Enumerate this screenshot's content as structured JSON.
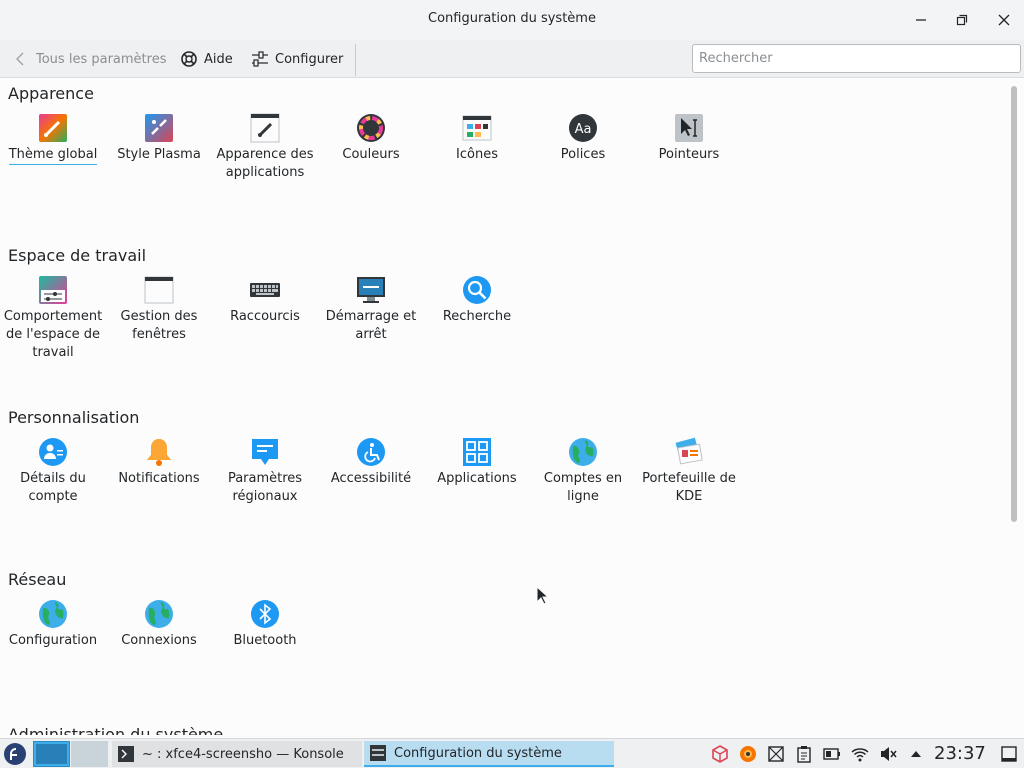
{
  "window": {
    "title": "Configuration du système"
  },
  "toolbar": {
    "back": "Tous les paramètres",
    "help": "Aide",
    "configure": "Configurer"
  },
  "search": {
    "placeholder": "Rechercher"
  },
  "sections": [
    {
      "title": "Apparence",
      "items": [
        "Thème global",
        "Style Plasma",
        "Apparence des applications",
        "Couleurs",
        "Icônes",
        "Polices",
        "Pointeurs"
      ]
    },
    {
      "title": "Espace de travail",
      "items": [
        "Comportement de l'espace de travail",
        "Gestion des fenêtres",
        "Raccourcis",
        "Démarrage et arrêt",
        "Recherche"
      ]
    },
    {
      "title": "Personnalisation",
      "items": [
        "Détails du compte",
        "Notifications",
        "Paramètres régionaux",
        "Accessibilité",
        "Applications",
        "Comptes en ligne",
        "Portefeuille de KDE"
      ]
    },
    {
      "title": "Réseau",
      "items": [
        "Configuration",
        "Connexions",
        "Bluetooth"
      ]
    },
    {
      "title": "Administration du système",
      "items": []
    }
  ],
  "labels": {
    "s0": "Apparence",
    "s1": "Espace de travail",
    "s2": "Personnalisation",
    "s3": "Réseau",
    "s4": "Administration du système",
    "a0a": "Thème global",
    "a1a": "Style Plasma",
    "a2a": "Apparence des",
    "a2b": "applications",
    "a3a": "Couleurs",
    "a4a": "Icônes",
    "a5a": "Polices",
    "a6a": "Pointeurs",
    "e0a": "Comportement",
    "e0b": "de l'espace de",
    "e0c": "travail",
    "e1a": "Gestion des",
    "e1b": "fenêtres",
    "e2a": "Raccourcis",
    "e3a": "Démarrage et",
    "e3b": "arrêt",
    "e4a": "Recherche",
    "p0a": "Détails du",
    "p0b": "compte",
    "p1a": "Notifications",
    "p2a": "Paramètres",
    "p2b": "régionaux",
    "p3a": "Accessibilité",
    "p4a": "Applications",
    "p5a": "Comptes en",
    "p5b": "ligne",
    "p6a": "Portefeuille de",
    "p6b": "KDE",
    "r0a": "Configuration",
    "r1a": "Connexions",
    "r2a": "Bluetooth"
  },
  "taskbar": {
    "konsole": "~ : xfce4-screensho — Konsole",
    "settings": "Configuration du système",
    "clock": "23:37"
  },
  "colors": {
    "accent": "#3daee9",
    "selected_underline": "#3daee9"
  }
}
